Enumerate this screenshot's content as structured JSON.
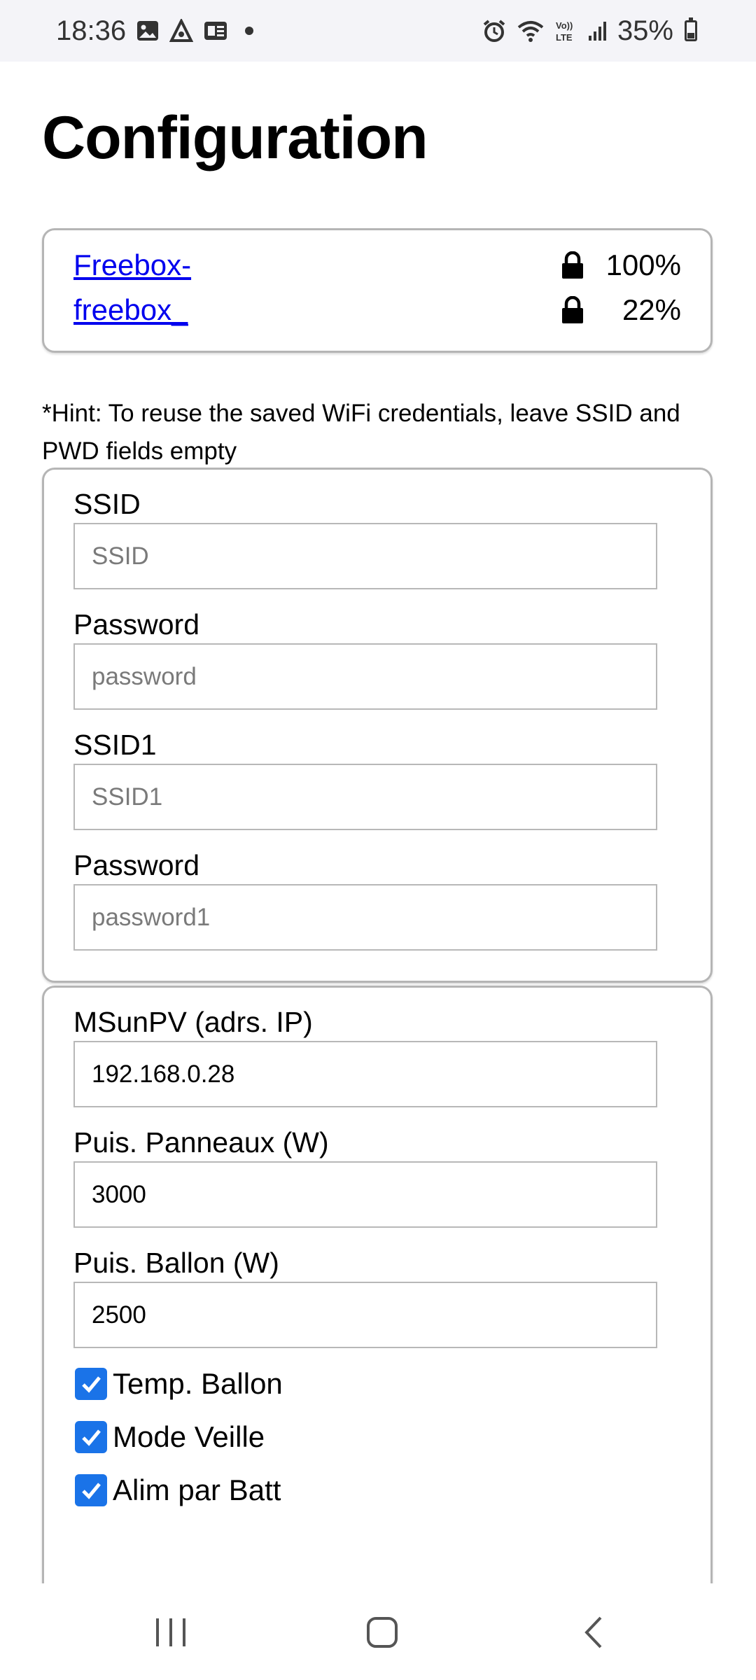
{
  "status_bar": {
    "time": "18:36",
    "left_icons": [
      "image-icon",
      "app-icon",
      "news-icon"
    ],
    "right_icons": [
      "alarm-icon",
      "wifi-icon",
      "volte-icon",
      "signal-icon"
    ],
    "battery": "35%"
  },
  "page": {
    "title": "Configuration"
  },
  "networks": [
    {
      "ssid": "Freebox-",
      "strength": "100%",
      "secured": true
    },
    {
      "ssid": "freebox_",
      "strength": "22%",
      "secured": true
    }
  ],
  "hint": "*Hint: To reuse the saved WiFi credentials, leave SSID and PWD fields empty",
  "wifi_form": {
    "ssid_label": "SSID",
    "ssid_placeholder": "SSID",
    "password_label": "Password",
    "password_placeholder": "password",
    "ssid1_label": "SSID1",
    "ssid1_placeholder": "SSID1",
    "password1_label": "Password",
    "password1_placeholder": "password1"
  },
  "settings_form": {
    "ip_label": "MSunPV (adrs. IP)",
    "ip_value": "192.168.0.28",
    "panels_label": "Puis. Panneaux (W)",
    "panels_value": "3000",
    "tank_label": "Puis. Ballon (W)",
    "tank_value": "2500",
    "checkboxes": [
      {
        "label": "Temp. Ballon",
        "checked": true
      },
      {
        "label": "Mode Veille",
        "checked": true
      },
      {
        "label": "Alim par Batt",
        "checked": true
      }
    ]
  },
  "colors": {
    "link": "#0000ee",
    "checkbox": "#1a73e8",
    "border": "#b5b5b5"
  }
}
